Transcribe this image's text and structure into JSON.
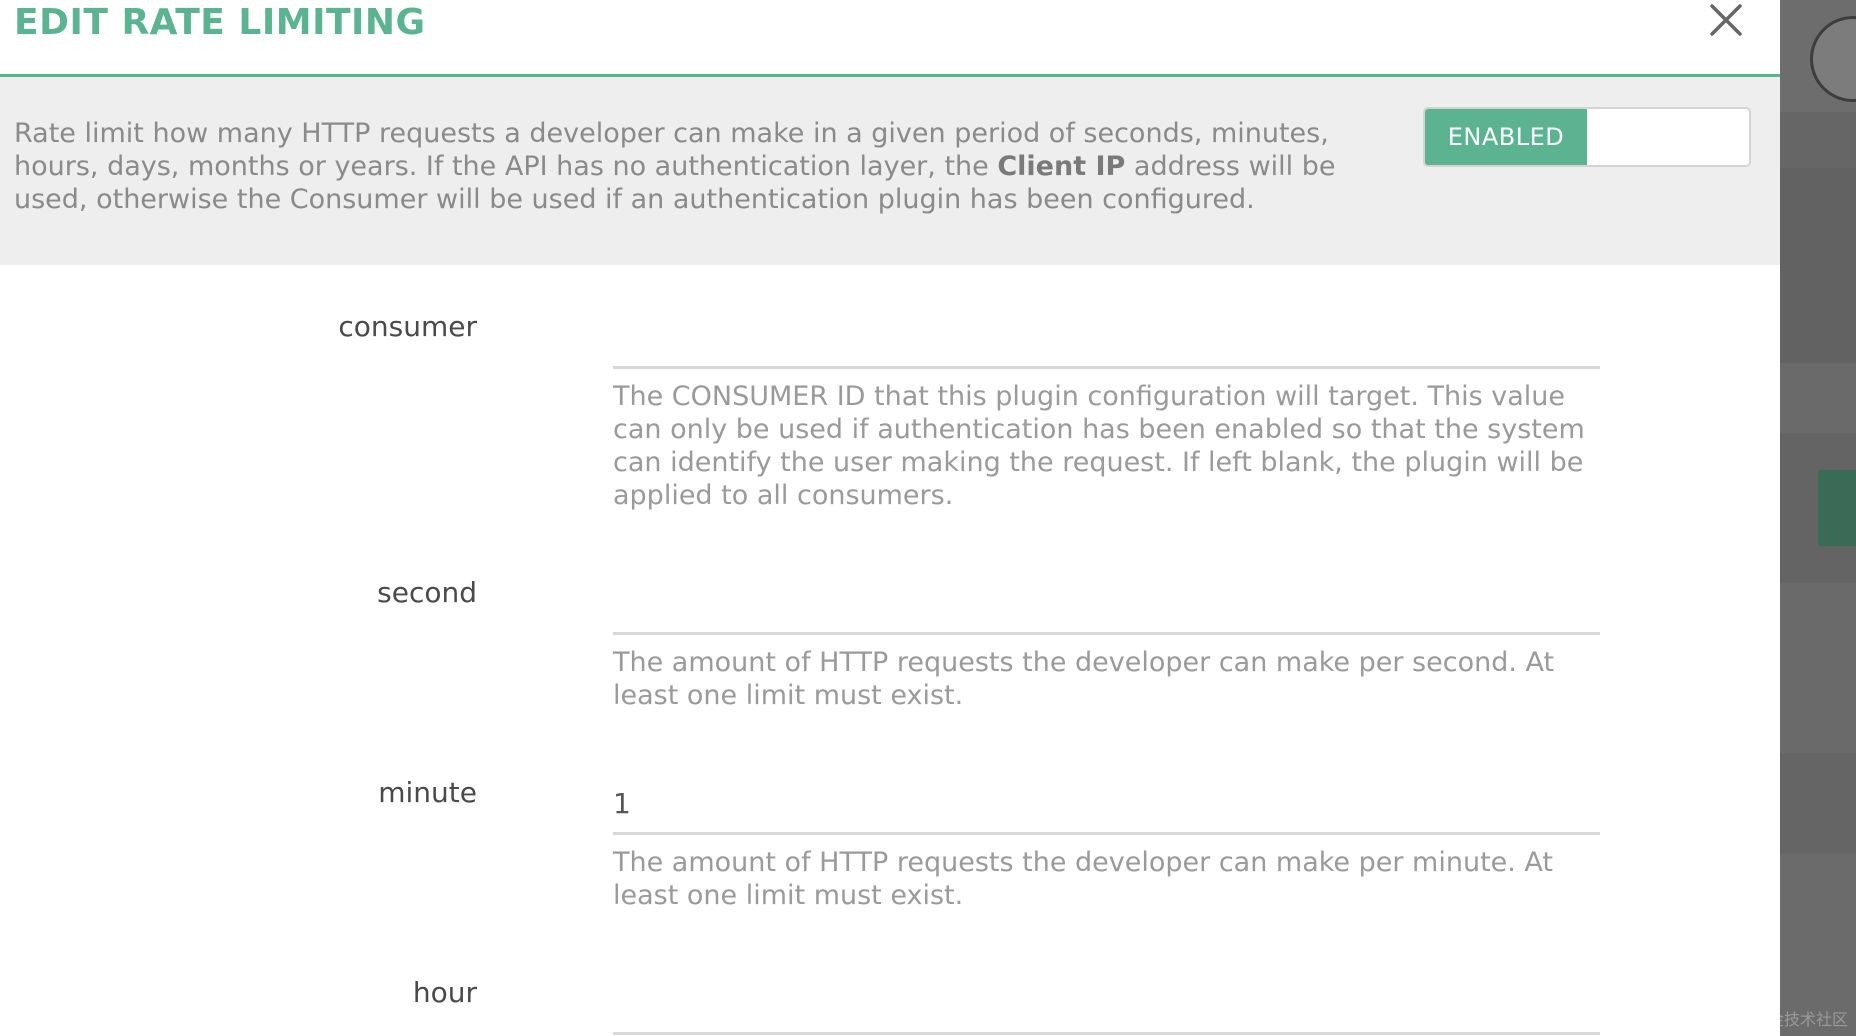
{
  "modal": {
    "title": "EDIT RATE LIMITING",
    "close_icon": "close-icon",
    "description_parts": {
      "before": "Rate limit how many HTTP requests a developer can make in a given period of seconds, minutes, hours, days, months or years. If the API has no authentication layer, the ",
      "emphasis": "Client IP",
      "after": " address will be used, otherwise the Consumer will be used if an authentication plugin has been configured."
    },
    "toggle": {
      "on_label": "ENABLED",
      "off_label": ""
    }
  },
  "fields": {
    "consumer": {
      "label": "consumer",
      "value": "",
      "help": "The CONSUMER ID that this plugin configuration will target. This value can only be used if authentication has been enabled so that the system can identify the user making the request. If left blank, the plugin will be applied to all consumers."
    },
    "second": {
      "label": "second",
      "value": "",
      "help": "The amount of HTTP requests the developer can make per second. At least one limit must exist."
    },
    "minute": {
      "label": "minute",
      "value": "1",
      "help": "The amount of HTTP requests the developer can make per minute. At least one limit must exist."
    },
    "hour": {
      "label": "hour",
      "value": ""
    }
  },
  "watermark": "@稀土掘金技术社区",
  "colors": {
    "accent": "#5bb391",
    "intro_bg": "#eeeeee",
    "overlay": "#5e5e5e"
  }
}
